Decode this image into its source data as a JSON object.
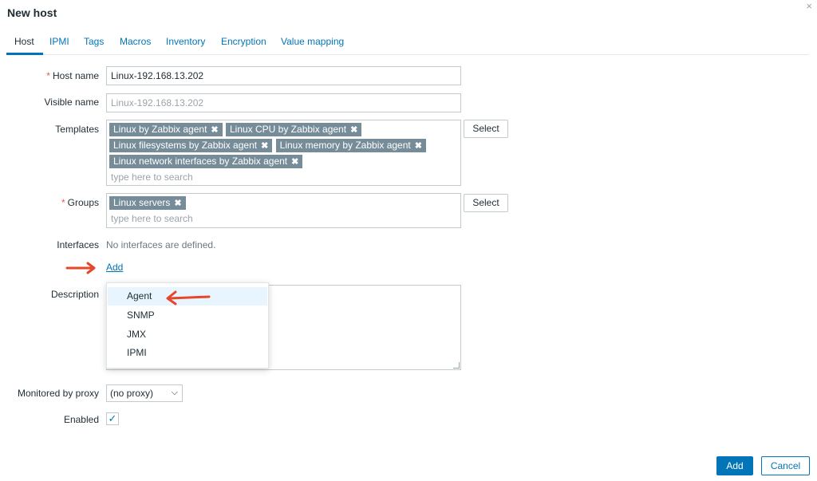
{
  "dialog": {
    "title": "New host",
    "close_glyph": "×"
  },
  "tabs": [
    {
      "label": "Host",
      "active": true
    },
    {
      "label": "IPMI"
    },
    {
      "label": "Tags"
    },
    {
      "label": "Macros"
    },
    {
      "label": "Inventory"
    },
    {
      "label": "Encryption"
    },
    {
      "label": "Value mapping"
    }
  ],
  "form": {
    "host_name": {
      "label": "Host name",
      "required": true,
      "value": "Linux-192.168.13.202"
    },
    "visible_name": {
      "label": "Visible name",
      "placeholder": "Linux-192.168.13.202"
    },
    "templates": {
      "label": "Templates",
      "chips": [
        "Linux by Zabbix agent",
        "Linux CPU by Zabbix agent",
        "Linux filesystems by Zabbix agent",
        "Linux memory by Zabbix agent",
        "Linux network interfaces by Zabbix agent"
      ],
      "search_placeholder": "type here to search",
      "select_label": "Select"
    },
    "groups": {
      "label": "Groups",
      "required": true,
      "chips": [
        "Linux servers"
      ],
      "search_placeholder": "type here to search",
      "select_label": "Select"
    },
    "interfaces": {
      "label": "Interfaces",
      "empty_text": "No interfaces are defined.",
      "add_link": "Add"
    },
    "description": {
      "label": "Description"
    },
    "add_interface_menu": {
      "items": [
        "Agent",
        "SNMP",
        "JMX",
        "IPMI"
      ],
      "hovered": "Agent"
    },
    "proxy": {
      "label": "Monitored by proxy",
      "value": "(no proxy)"
    },
    "enabled": {
      "label": "Enabled",
      "checked": true,
      "check_glyph": "✓"
    }
  },
  "footer": {
    "add_label": "Add",
    "cancel_label": "Cancel"
  },
  "colors": {
    "accent": "#0275b8",
    "chip": "#768d99",
    "required": "#e45959",
    "annotation_arrow": "#e8462a"
  },
  "glyphs": {
    "chip_remove": "✖",
    "select_chevron": "⌵"
  }
}
